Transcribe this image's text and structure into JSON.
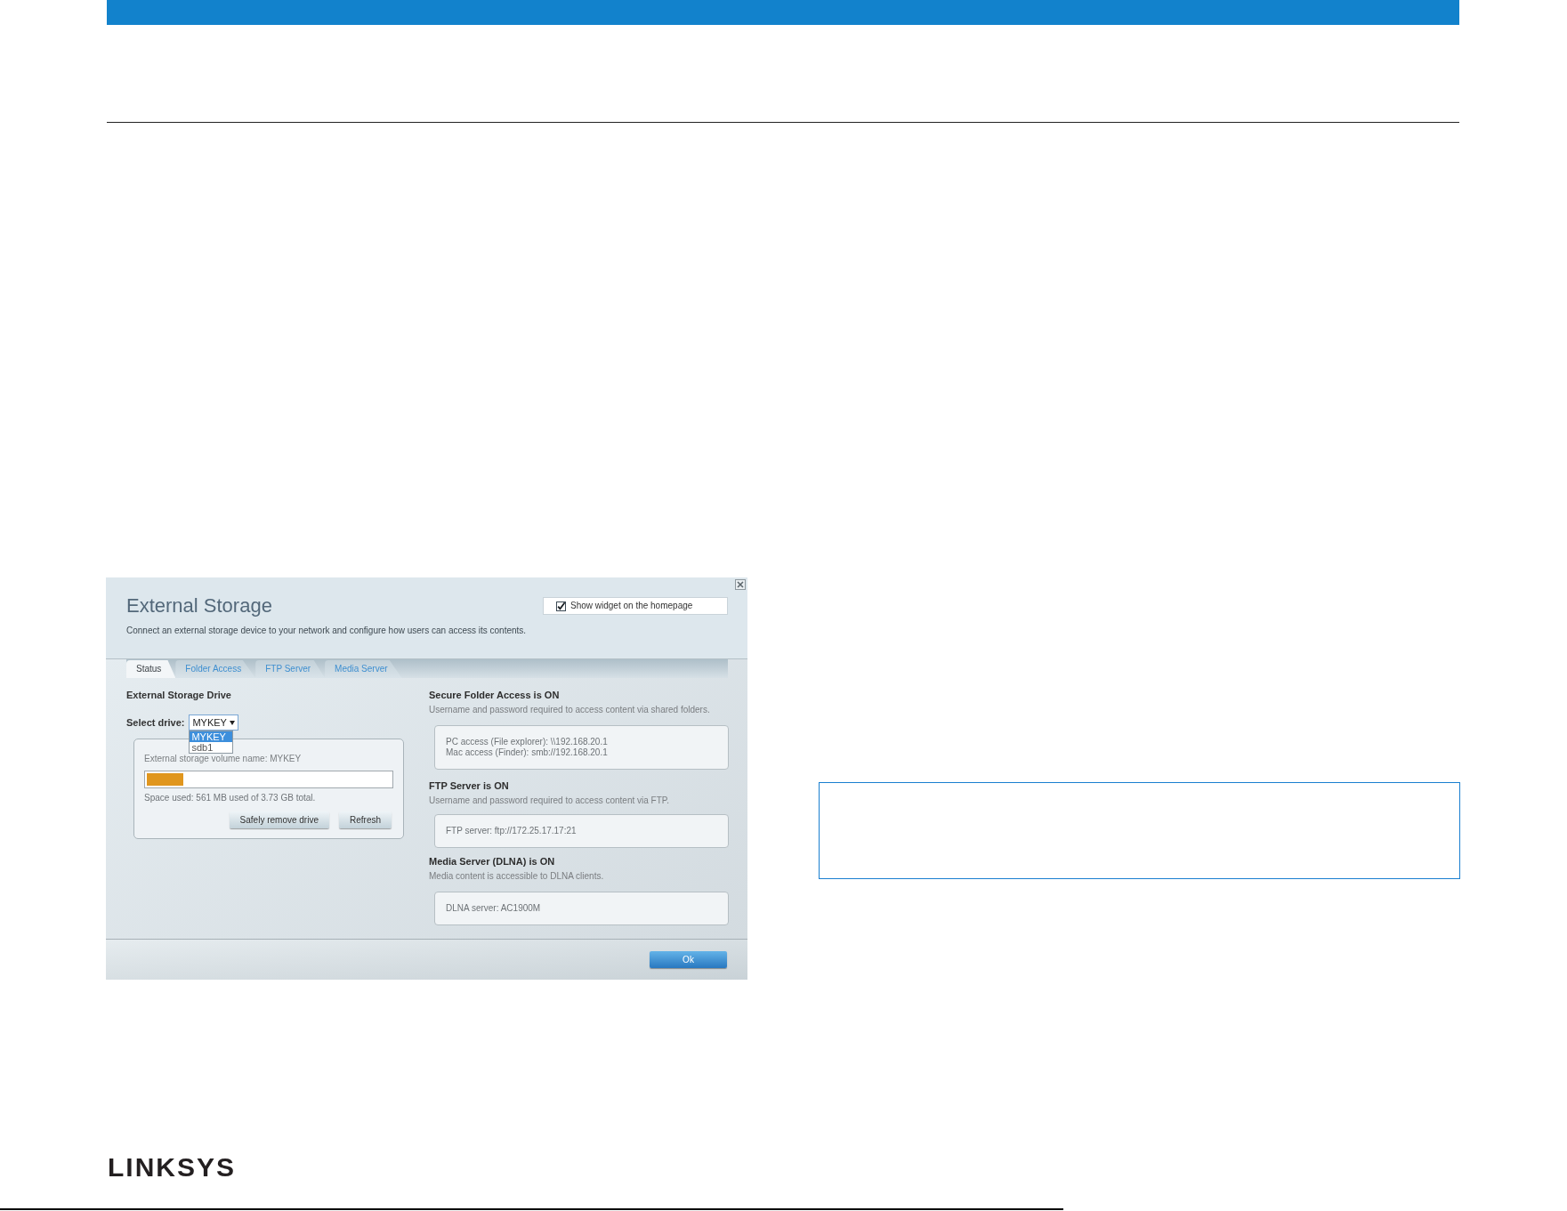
{
  "dialog": {
    "title": "External Storage",
    "subtitle": "Connect an external storage device to your network and configure how users can access its contents.",
    "widget_checkbox": {
      "label": "Show widget on the homepage",
      "checked": true
    },
    "tabs": [
      {
        "label": "Status",
        "selected": true
      },
      {
        "label": "Folder Access",
        "selected": false
      },
      {
        "label": "FTP Server",
        "selected": false
      },
      {
        "label": "Media Server",
        "selected": false
      }
    ],
    "drive_section": {
      "heading": "External Storage Drive",
      "select_label": "Select drive:",
      "select_value": "MYKEY",
      "options": [
        {
          "label": "MYKEY",
          "selected": true
        },
        {
          "label": "sdb1",
          "selected": false
        }
      ],
      "volume_name": "External storage volume name: MYKEY",
      "usage": {
        "level": 0.15
      },
      "space_text": "Space used: 561 MB used of 3.73 GB total.",
      "buttons": [
        "Safely remove drive",
        "Refresh"
      ]
    },
    "services": [
      {
        "heading": "Secure Folder Access is ON",
        "description": "Username and password required to access content via shared folders.",
        "details": [
          "PC access (File explorer): \\\\192.168.20.1",
          "Mac access (Finder): smb://192.168.20.1"
        ]
      },
      {
        "heading": "FTP Server is ON",
        "description": "Username and password required to access content via FTP.",
        "details": [
          "FTP server: ftp://172.25.17.17:21"
        ]
      },
      {
        "heading": "Media Server (DLNA) is ON",
        "description": "Media content is accessible to DLNA clients.",
        "details": [
          "DLNA server: AC1900M"
        ]
      }
    ],
    "footer_button": "Ok"
  },
  "logo": "LINKSYS"
}
